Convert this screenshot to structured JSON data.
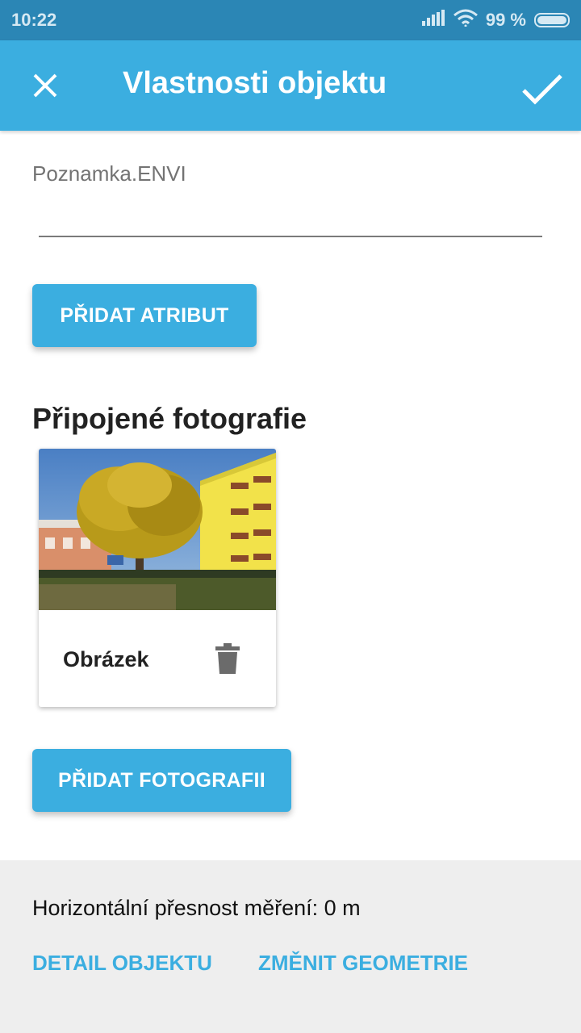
{
  "status_bar": {
    "time": "10:22",
    "battery_text": "99 %",
    "battery_level": 0.99,
    "icons": [
      "signal-icon",
      "wifi-icon",
      "battery-icon"
    ]
  },
  "app_bar": {
    "title": "Vlastnosti objektu",
    "close_icon": "close-icon",
    "confirm_icon": "check-icon",
    "background": "#3baee0"
  },
  "form": {
    "field_label": "Poznamka.ENVI",
    "field_value": ""
  },
  "buttons": {
    "add_attribute": "PŘIDAT ATRIBUT",
    "add_photo": "PŘIDAT FOTOGRAFII"
  },
  "photos": {
    "heading": "Připojené fotografie",
    "items": [
      {
        "caption": "Obrázek",
        "delete_icon": "trash-icon"
      }
    ]
  },
  "footer": {
    "accuracy": "Horizontální přesnost měření: 0 m",
    "detail_link": "DETAIL OBJEKTU",
    "geometry_link": "ZMĚNIT GEOMETRIE"
  },
  "colors": {
    "status_bar": "#2b86b5",
    "accent": "#3baee0",
    "footer_bg": "#eeeeee"
  }
}
